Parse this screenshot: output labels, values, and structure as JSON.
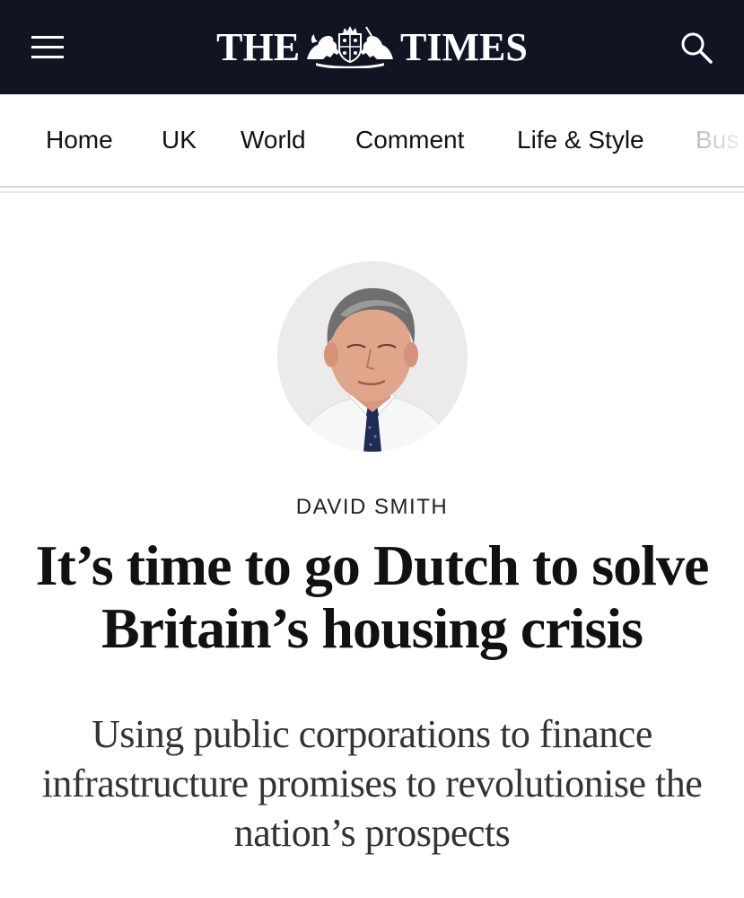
{
  "masthead": {
    "left_word": "THE",
    "right_word": "TIMES",
    "crest_icon": "royal-crest-icon"
  },
  "header": {
    "menu_icon": "hamburger-menu-icon",
    "search_icon": "search-icon"
  },
  "nav": {
    "items": [
      {
        "label": "Home"
      },
      {
        "label": "UK"
      },
      {
        "label": "World"
      },
      {
        "label": "Comment"
      },
      {
        "label": "Life & Style"
      },
      {
        "label": "Bus"
      }
    ]
  },
  "article": {
    "author": "DAVID SMITH",
    "author_photo": "author-portrait",
    "headline": "It’s time to go Dutch to solve Britain’s housing crisis",
    "standfirst": "Using public corporations to finance infrastructure promises to revolutionise the nation’s prospects"
  },
  "colors": {
    "header_bg": "#101423",
    "text": "#111111",
    "nav_partial": "#9a9a9a"
  }
}
